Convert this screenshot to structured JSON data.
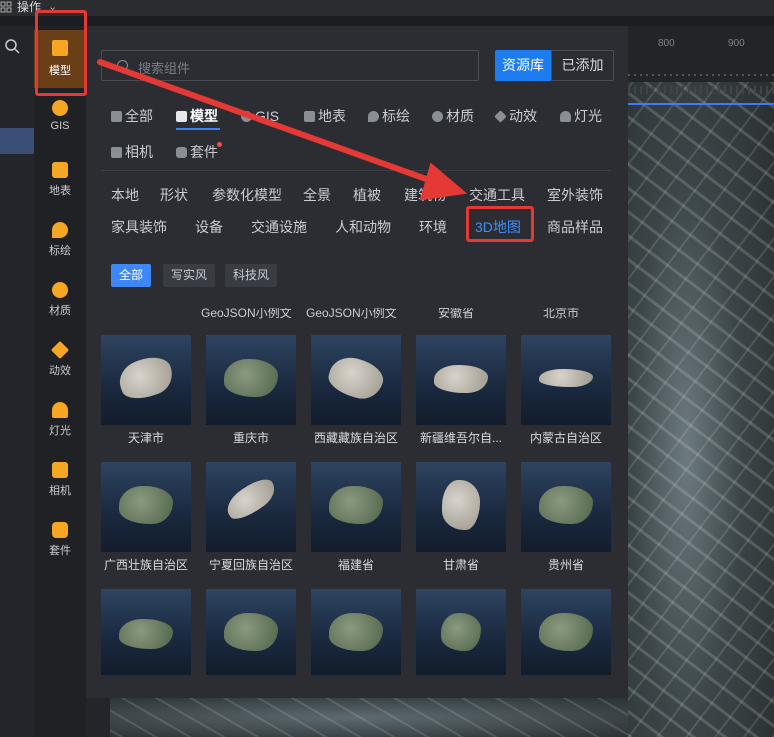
{
  "topbar": {
    "title": "操作"
  },
  "categories": [
    {
      "label": "模型",
      "icon": "cube-icon",
      "active": true
    },
    {
      "label": "GIS",
      "icon": "globe-icon",
      "active": false
    },
    {
      "label": "地表",
      "icon": "terrain-icon",
      "active": false
    },
    {
      "label": "标绘",
      "icon": "map-pin-icon",
      "active": false
    },
    {
      "label": "材质",
      "icon": "material-ball-icon",
      "active": false
    },
    {
      "label": "动效",
      "icon": "sparkle-icon",
      "active": false
    },
    {
      "label": "灯光",
      "icon": "lamp-icon",
      "active": false
    },
    {
      "label": "相机",
      "icon": "camera-icon",
      "active": false
    },
    {
      "label": "套件",
      "icon": "package-icon",
      "active": false
    }
  ],
  "search": {
    "placeholder": "搜索组件"
  },
  "source_tabs": {
    "library": "资源库",
    "added": "已添加"
  },
  "type_tabs": [
    "全部",
    "模型",
    "GIS",
    "地表",
    "标绘",
    "材质",
    "动效",
    "灯光",
    "相机",
    "套件"
  ],
  "subcategories": {
    "row1": [
      "本地",
      "形状",
      "参数化模型",
      "全景",
      "植被",
      "建筑物",
      "交通工具",
      "室外装饰"
    ],
    "row2": [
      "家具装饰",
      "设备",
      "交通设施",
      "人和动物",
      "环境",
      "3D地图",
      "商品样品"
    ]
  },
  "styles": [
    "全部",
    "写实风",
    "科技风"
  ],
  "partial_labels": [
    "GeoJSON小例文...",
    "GeoJSON小例文...",
    "安徽省",
    "北京市"
  ],
  "grid": [
    [
      "天津市",
      "重庆市",
      "西藏藏族自治区",
      "新疆维吾尔自...",
      "内蒙古自治区"
    ],
    [
      "广西壮族自治区",
      "宁夏回族自治区",
      "福建省",
      "甘肃省",
      "贵州省"
    ]
  ],
  "ruler": {
    "t1": "800",
    "t2": "900"
  },
  "colors": {
    "accent": "#1e7cf1",
    "highlight": "#e53935",
    "active_category": "#6a3e16"
  }
}
